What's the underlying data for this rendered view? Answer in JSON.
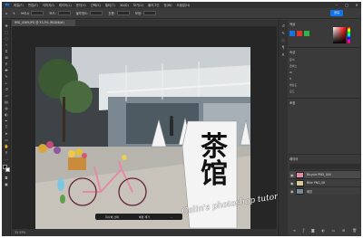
{
  "app": {
    "logo": "Ps",
    "menus": [
      "파일(F)",
      "편집(E)",
      "이미지(I)",
      "레이어(L)",
      "문자(Y)",
      "선택(S)",
      "필터(T)",
      "3D(D)",
      "보기(V)",
      "플러그인",
      "창(W)",
      "도움말(H)"
    ],
    "share_label": "공유"
  },
  "options": {
    "items": [
      "브러시",
      "모드:",
      "불투명도:",
      "흐름:",
      "보정:"
    ]
  },
  "document": {
    "tab_title": "IMG_4569.JPG @ 33.3% (RGB/8/#)",
    "zoom_status": "33.33%",
    "sign_text": "茶馆"
  },
  "context_bar": {
    "items": [
      "피사체 선택",
      "배경 제거",
      "..."
    ]
  },
  "watermark": "Calin's photoshop tutorial",
  "panels": {
    "color_header": "색상",
    "properties_header": "속성",
    "adjust_header": "조정",
    "layers_header": "레이어",
    "props_rows": [
      "문서",
      "캔버스",
      "W",
      "H",
      "해상도",
      "모드"
    ],
    "layers": [
      {
        "name": "Bicycle PNG_004"
      },
      {
        "name": "Bike PNG_08"
      },
      {
        "name": "배경"
      }
    ]
  },
  "colors": {
    "accent": "#1473e6",
    "foreground": "#000000",
    "background": "#ffffff"
  }
}
